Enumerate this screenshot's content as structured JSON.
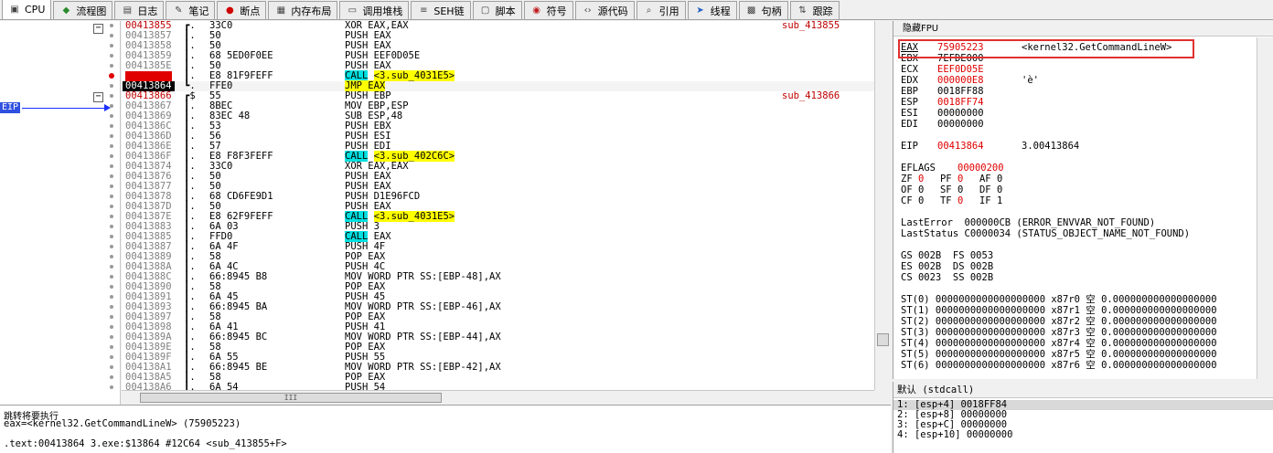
{
  "tabs": [
    {
      "label": "CPU",
      "icon": "cpu-icon",
      "active": true
    },
    {
      "label": "流程图",
      "icon": "graph-icon"
    },
    {
      "label": "日志",
      "icon": "log-icon"
    },
    {
      "label": "笔记",
      "icon": "notes-icon"
    },
    {
      "label": "断点",
      "icon": "breakpoint-icon"
    },
    {
      "label": "内存布局",
      "icon": "memory-map-icon"
    },
    {
      "label": "调用堆栈",
      "icon": "call-stack-icon"
    },
    {
      "label": "SEH链",
      "icon": "seh-icon"
    },
    {
      "label": "脚本",
      "icon": "script-icon"
    },
    {
      "label": "符号",
      "icon": "symbols-icon"
    },
    {
      "label": "源代码",
      "icon": "source-icon"
    },
    {
      "label": "引用",
      "icon": "references-icon"
    },
    {
      "label": "线程",
      "icon": "threads-icon"
    },
    {
      "label": "句柄",
      "icon": "handles-icon"
    },
    {
      "label": "跟踪",
      "icon": "trace-icon"
    }
  ],
  "eip_label": "EIP",
  "disasm": [
    {
      "addr": "00413855",
      "br": "┏.",
      "bytes": "33C0",
      "instr": [
        {
          "t": "XOR EAX,EAX"
        }
      ],
      "cmt": "sub_413855",
      "kind": "first"
    },
    {
      "addr": "00413857",
      "br": "┃.",
      "bytes": "50",
      "instr": [
        {
          "t": "PUSH EAX"
        }
      ]
    },
    {
      "addr": "00413858",
      "br": "┃.",
      "bytes": "50",
      "instr": [
        {
          "t": "PUSH EAX"
        }
      ]
    },
    {
      "addr": "00413859",
      "br": "┃.",
      "bytes": "68 5ED0F0EE",
      "instr": [
        {
          "t": "PUSH EEF0D05E"
        }
      ]
    },
    {
      "addr": "0041385E",
      "br": "┃.",
      "bytes": "50",
      "instr": [
        {
          "t": "PUSH EAX"
        }
      ]
    },
    {
      "addr": "0041385F",
      "br": "┃.",
      "bytes": "E8 81F9FEFF",
      "instr": [
        {
          "t": "CALL",
          "c": "kw-call"
        },
        {
          "t": " "
        },
        {
          "t": "<3.sub_4031E5>",
          "c": "tgt"
        }
      ],
      "kind": "bp"
    },
    {
      "addr": "00413864",
      "br": "┗.",
      "bytes": "FFE0",
      "instr": [
        {
          "t": "JMP EAX",
          "c": "kw-jmp"
        }
      ],
      "kind": "cur"
    },
    {
      "addr": "00413866",
      "br": "┏$",
      "bytes": "55",
      "instr": [
        {
          "t": "PUSH EBP"
        }
      ],
      "cmt": "sub_413866",
      "kind": "first"
    },
    {
      "addr": "00413867",
      "br": "┃.",
      "bytes": "8BEC",
      "instr": [
        {
          "t": "MOV EBP,ESP"
        }
      ]
    },
    {
      "addr": "00413869",
      "br": "┃.",
      "bytes": "83EC 48",
      "instr": [
        {
          "t": "SUB ESP,48"
        }
      ]
    },
    {
      "addr": "0041386C",
      "br": "┃.",
      "bytes": "53",
      "instr": [
        {
          "t": "PUSH EBX"
        }
      ]
    },
    {
      "addr": "0041386D",
      "br": "┃.",
      "bytes": "56",
      "instr": [
        {
          "t": "PUSH ESI"
        }
      ]
    },
    {
      "addr": "0041386E",
      "br": "┃.",
      "bytes": "57",
      "instr": [
        {
          "t": "PUSH EDI"
        }
      ]
    },
    {
      "addr": "0041386F",
      "br": "┃.",
      "bytes": "E8 F8F3FEFF",
      "instr": [
        {
          "t": "CALL",
          "c": "kw-call"
        },
        {
          "t": " "
        },
        {
          "t": "<3.sub_402C6C>",
          "c": "tgt"
        }
      ]
    },
    {
      "addr": "00413874",
      "br": "┃.",
      "bytes": "33C0",
      "instr": [
        {
          "t": "XOR EAX,EAX"
        }
      ]
    },
    {
      "addr": "00413876",
      "br": "┃.",
      "bytes": "50",
      "instr": [
        {
          "t": "PUSH EAX"
        }
      ]
    },
    {
      "addr": "00413877",
      "br": "┃.",
      "bytes": "50",
      "instr": [
        {
          "t": "PUSH EAX"
        }
      ]
    },
    {
      "addr": "00413878",
      "br": "┃.",
      "bytes": "68 CD6FE9D1",
      "instr": [
        {
          "t": "PUSH D1E96FCD"
        }
      ]
    },
    {
      "addr": "0041387D",
      "br": "┃.",
      "bytes": "50",
      "instr": [
        {
          "t": "PUSH EAX"
        }
      ]
    },
    {
      "addr": "0041387E",
      "br": "┃.",
      "bytes": "E8 62F9FEFF",
      "instr": [
        {
          "t": "CALL",
          "c": "kw-call"
        },
        {
          "t": " "
        },
        {
          "t": "<3.sub_4031E5>",
          "c": "tgt"
        }
      ]
    },
    {
      "addr": "00413883",
      "br": "┃.",
      "bytes": "6A 03",
      "instr": [
        {
          "t": "PUSH 3"
        }
      ]
    },
    {
      "addr": "00413885",
      "br": "┃.",
      "bytes": "FFD0",
      "instr": [
        {
          "t": "CALL",
          "c": "kw-call"
        },
        {
          "t": " EAX"
        }
      ]
    },
    {
      "addr": "00413887",
      "br": "┃.",
      "bytes": "6A 4F",
      "instr": [
        {
          "t": "PUSH 4F"
        }
      ]
    },
    {
      "addr": "00413889",
      "br": "┃.",
      "bytes": "58",
      "instr": [
        {
          "t": "POP EAX"
        }
      ]
    },
    {
      "addr": "0041388A",
      "br": "┃.",
      "bytes": "6A 4C",
      "instr": [
        {
          "t": "PUSH 4C"
        }
      ]
    },
    {
      "addr": "0041388C",
      "br": "┃.",
      "bytes": "66:8945 B8",
      "instr": [
        {
          "t": "MOV WORD PTR SS:[EBP-48],AX"
        }
      ]
    },
    {
      "addr": "00413890",
      "br": "┃.",
      "bytes": "58",
      "instr": [
        {
          "t": "POP EAX"
        }
      ]
    },
    {
      "addr": "00413891",
      "br": "┃.",
      "bytes": "6A 45",
      "instr": [
        {
          "t": "PUSH 45"
        }
      ]
    },
    {
      "addr": "00413893",
      "br": "┃.",
      "bytes": "66:8945 BA",
      "instr": [
        {
          "t": "MOV WORD PTR SS:[EBP-46],AX"
        }
      ]
    },
    {
      "addr": "00413897",
      "br": "┃.",
      "bytes": "58",
      "instr": [
        {
          "t": "POP EAX"
        }
      ]
    },
    {
      "addr": "00413898",
      "br": "┃.",
      "bytes": "6A 41",
      "instr": [
        {
          "t": "PUSH 41"
        }
      ]
    },
    {
      "addr": "0041389A",
      "br": "┃.",
      "bytes": "66:8945 BC",
      "instr": [
        {
          "t": "MOV WORD PTR SS:[EBP-44],AX"
        }
      ]
    },
    {
      "addr": "0041389E",
      "br": "┃.",
      "bytes": "58",
      "instr": [
        {
          "t": "POP EAX"
        }
      ]
    },
    {
      "addr": "0041389F",
      "br": "┃.",
      "bytes": "6A 55",
      "instr": [
        {
          "t": "PUSH 55"
        }
      ]
    },
    {
      "addr": "004138A1",
      "br": "┃.",
      "bytes": "66:8945 BE",
      "instr": [
        {
          "t": "MOV WORD PTR SS:[EBP-42],AX"
        }
      ]
    },
    {
      "addr": "004138A5",
      "br": "┃.",
      "bytes": "58",
      "instr": [
        {
          "t": "POP EAX"
        }
      ]
    },
    {
      "addr": "004138A6",
      "br": "┃.",
      "bytes": "6A 54",
      "instr": [
        {
          "t": "PUSH 54"
        }
      ]
    }
  ],
  "hscroll_label": "III",
  "info": {
    "line1": "跳转将要执行",
    "line2": "eax=<kernel32.GetCommandLineW> (75905223)",
    "line3": ".text:00413864 3.exe:$13864 #12C64 <sub_413855+F>"
  },
  "registers": {
    "title": "隐藏FPU",
    "rows": [
      {
        "n": "EAX",
        "v": "75905223",
        "red": true,
        "c": "<kernel32.GetCommandLineW>"
      },
      {
        "n": "EBX",
        "v": "7EFDE000",
        "red": false,
        "c": ""
      },
      {
        "n": "ECX",
        "v": "EEF0D05E",
        "red": true,
        "c": ""
      },
      {
        "n": "EDX",
        "v": "000000E8",
        "red": true,
        "c": "'è'"
      },
      {
        "n": "EBP",
        "v": "0018FF88",
        "red": false,
        "c": ""
      },
      {
        "n": "ESP",
        "v": "0018FF74",
        "red": true,
        "c": ""
      },
      {
        "n": "ESI",
        "v": "00000000",
        "red": false,
        "c": ""
      },
      {
        "n": "EDI",
        "v": "00000000",
        "red": false,
        "c": ""
      },
      {
        "gap": true
      },
      {
        "n": "EIP",
        "v": "00413864",
        "red": true,
        "c": "3.00413864"
      },
      {
        "gap": true
      },
      {
        "n": "EFLAGS",
        "v": "00000200",
        "red": true,
        "c": ""
      }
    ],
    "flags": [
      [
        {
          "n": "ZF",
          "v": "0",
          "red": true
        },
        {
          "n": "PF",
          "v": "0",
          "red": true
        },
        {
          "n": "AF",
          "v": "0",
          "red": false
        }
      ],
      [
        {
          "n": "OF",
          "v": "0",
          "red": false
        },
        {
          "n": "SF",
          "v": "0",
          "red": false
        },
        {
          "n": "DF",
          "v": "0",
          "red": false
        }
      ],
      [
        {
          "n": "CF",
          "v": "0",
          "red": false
        },
        {
          "n": "TF",
          "v": "0",
          "red": true
        },
        {
          "n": "IF",
          "v": "1",
          "red": false
        }
      ]
    ],
    "last_error": "LastError  000000CB (ERROR_ENVVAR_NOT_FOUND)",
    "last_status": "LastStatus C0000034 (STATUS_OBJECT_NAME_NOT_FOUND)",
    "segs": [
      "GS 002B  FS 0053",
      "ES 002B  DS 002B",
      "CS 0023  SS 002B"
    ],
    "fpu": [
      "ST(0) 0000000000000000000 x87r0 空 0.000000000000000000",
      "ST(1) 0000000000000000000 x87r1 空 0.000000000000000000",
      "ST(2) 0000000000000000000 x87r2 空 0.000000000000000000",
      "ST(3) 0000000000000000000 x87r3 空 0.000000000000000000",
      "ST(4) 0000000000000000000 x87r4 空 0.000000000000000000",
      "ST(5) 0000000000000000000 x87r5 空 0.000000000000000000",
      "ST(6) 0000000000000000000 x87r6 空 0.000000000000000000"
    ]
  },
  "stack": {
    "title": "默认 (stdcall)",
    "rows": [
      "1: [esp+4] 0018FF84",
      "2: [esp+8] 00000000",
      "3: [esp+C] 00000000",
      "4: [esp+10] 00000000"
    ]
  }
}
